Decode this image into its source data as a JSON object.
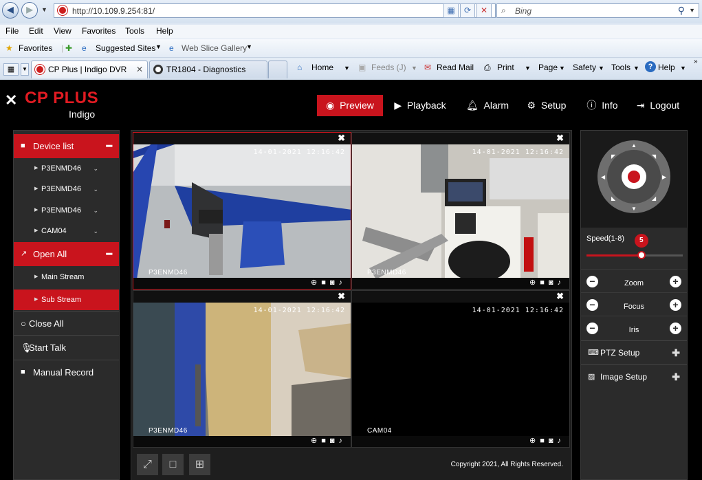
{
  "browser": {
    "url": "http://10.109.9.254:81/",
    "search_placeholder": "Bing",
    "menu": [
      "File",
      "Edit",
      "View",
      "Favorites",
      "Tools",
      "Help"
    ],
    "favorites_label": "Favorites",
    "suggested_sites": "Suggested Sites",
    "web_slice_gallery": "Web Slice Gallery",
    "tabs": [
      {
        "label": "CP Plus | Indigo DVR",
        "active": true
      },
      {
        "label": "TR1804 - Diagnostics",
        "active": false
      }
    ],
    "commands": {
      "home": "Home",
      "feeds": "Feeds (J)",
      "read_mail": "Read Mail",
      "print": "Print",
      "page": "Page",
      "safety": "Safety",
      "tools": "Tools",
      "help": "Help"
    }
  },
  "app": {
    "logo": "CP PLUS",
    "logo_sub": "Indigo",
    "nav": {
      "preview": "Preview",
      "playback": "Playback",
      "alarm": "Alarm",
      "setup": "Setup",
      "info": "Info",
      "logout": "Logout"
    },
    "left": {
      "device_list": "Device list",
      "devices": [
        "P3ENMD46",
        "P3ENMD46",
        "P3ENMD46",
        "CAM04"
      ],
      "open_all": "Open All",
      "main_stream": "Main Stream",
      "sub_stream": "Sub Stream",
      "close_all": "Close All",
      "start_talk": "Start Talk",
      "manual_record": "Manual Record"
    },
    "cells": [
      {
        "timestamp": "14-01-2021 12:16:42",
        "camera": "P3ENMD46"
      },
      {
        "timestamp": "14-01-2021 12:16:42",
        "camera": "P3ENMD46"
      },
      {
        "timestamp": "14-01-2021 12:16:42",
        "camera": "P3ENMD46"
      },
      {
        "timestamp": "14-01-2021 12:16:42",
        "camera": "CAM04"
      }
    ],
    "copyright": "Copyright 2021, All Rights Reserved.",
    "ptz": {
      "speed_label": "Speed(1-8)",
      "speed_value": "5",
      "speed_fraction": 0.57,
      "zoom": "Zoom",
      "focus": "Focus",
      "iris": "Iris",
      "ptz_setup": "PTZ Setup",
      "image_setup": "Image Setup"
    },
    "colors": {
      "accent": "#c9141d"
    }
  }
}
